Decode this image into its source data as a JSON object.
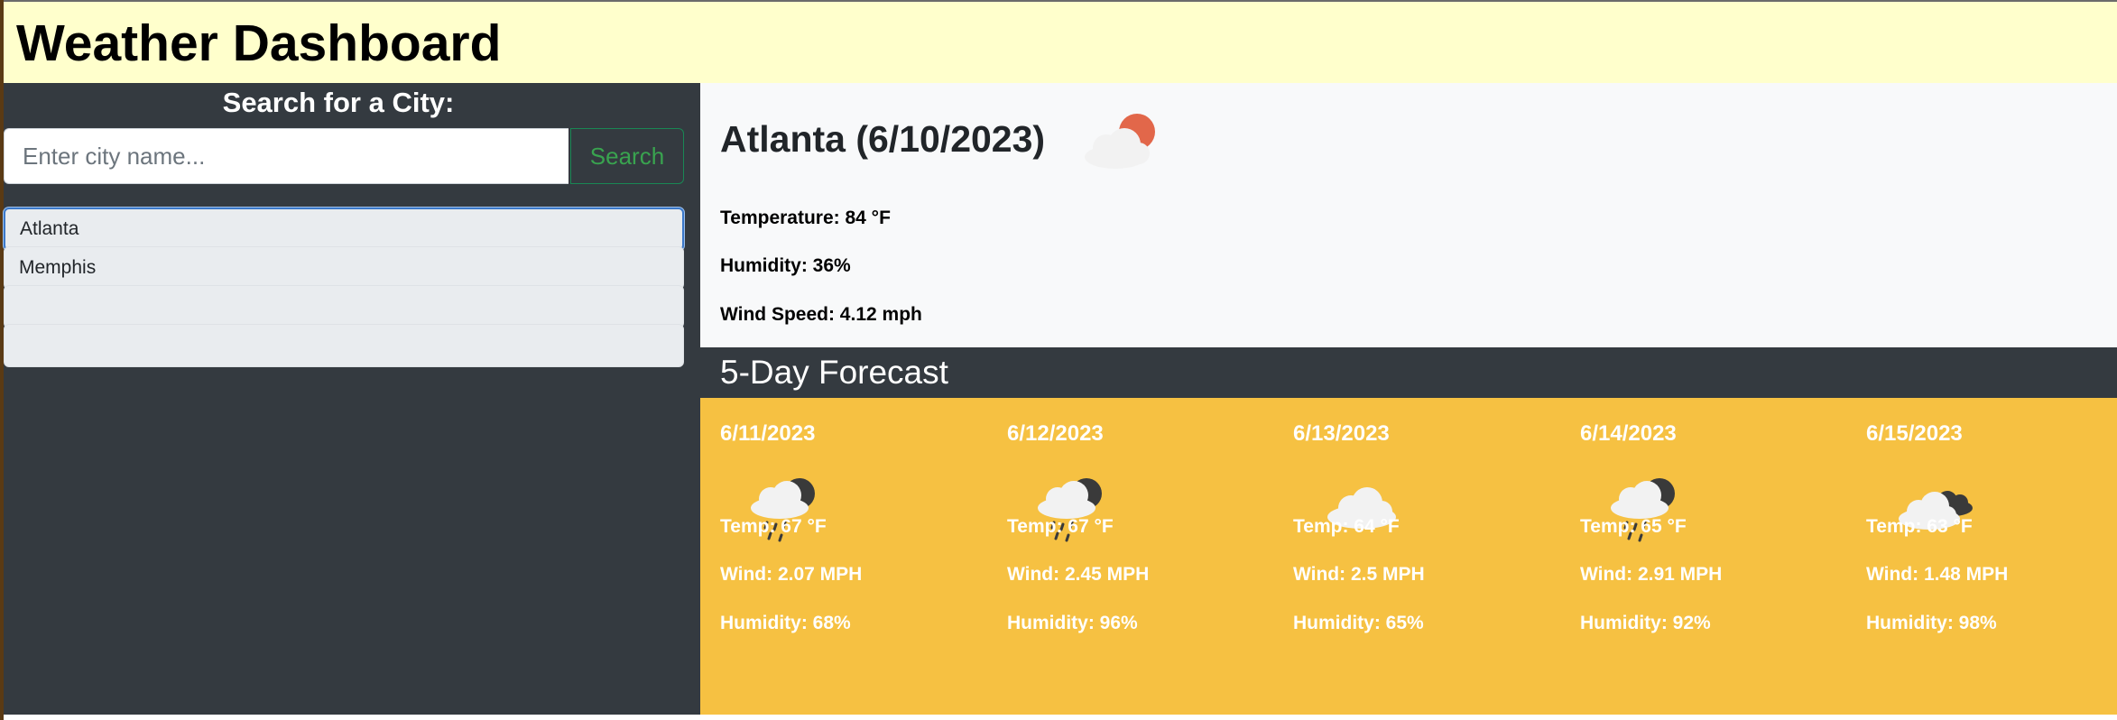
{
  "header": {
    "title": "Weather Dashboard"
  },
  "sidebar": {
    "search_title": "Search for a City:",
    "search_placeholder": "Enter city name...",
    "search_button": "Search",
    "history": [
      {
        "label": "Atlanta",
        "active": true
      },
      {
        "label": "Memphis",
        "active": false
      },
      {
        "label": "",
        "active": false
      },
      {
        "label": "",
        "active": false
      }
    ]
  },
  "current": {
    "title": "Atlanta (6/10/2023)",
    "icon": "partly-cloudy-day-icon",
    "temperature": "Temperature: 84 °F",
    "humidity": "Humidity: 36%",
    "wind": "Wind Speed: 4.12 mph"
  },
  "forecast": {
    "heading": "5-Day Forecast",
    "days": [
      {
        "date": "6/11/2023",
        "icon": "rain-night-icon",
        "temp": "Temp: 67 °F",
        "wind": "Wind: 2.07 MPH",
        "humidity": "Humidity: 68%"
      },
      {
        "date": "6/12/2023",
        "icon": "rain-night-icon",
        "temp": "Temp: 67 °F",
        "wind": "Wind: 2.45 MPH",
        "humidity": "Humidity: 96%"
      },
      {
        "date": "6/13/2023",
        "icon": "cloud-icon",
        "temp": "Temp: 64 °F",
        "wind": "Wind: 2.5 MPH",
        "humidity": "Humidity: 65%"
      },
      {
        "date": "6/14/2023",
        "icon": "rain-night-icon",
        "temp": "Temp: 65 °F",
        "wind": "Wind: 2.91 MPH",
        "humidity": "Humidity: 92%"
      },
      {
        "date": "6/15/2023",
        "icon": "broken-clouds-icon",
        "temp": "Temp: 63 °F",
        "wind": "Wind: 1.48 MPH",
        "humidity": "Humidity: 98%"
      }
    ]
  },
  "colors": {
    "header_bg": "#ffffcc",
    "dark": "#343a40",
    "forecast_bg": "#f6c142",
    "search_green": "#39a34f",
    "sun": "#e2674a"
  }
}
